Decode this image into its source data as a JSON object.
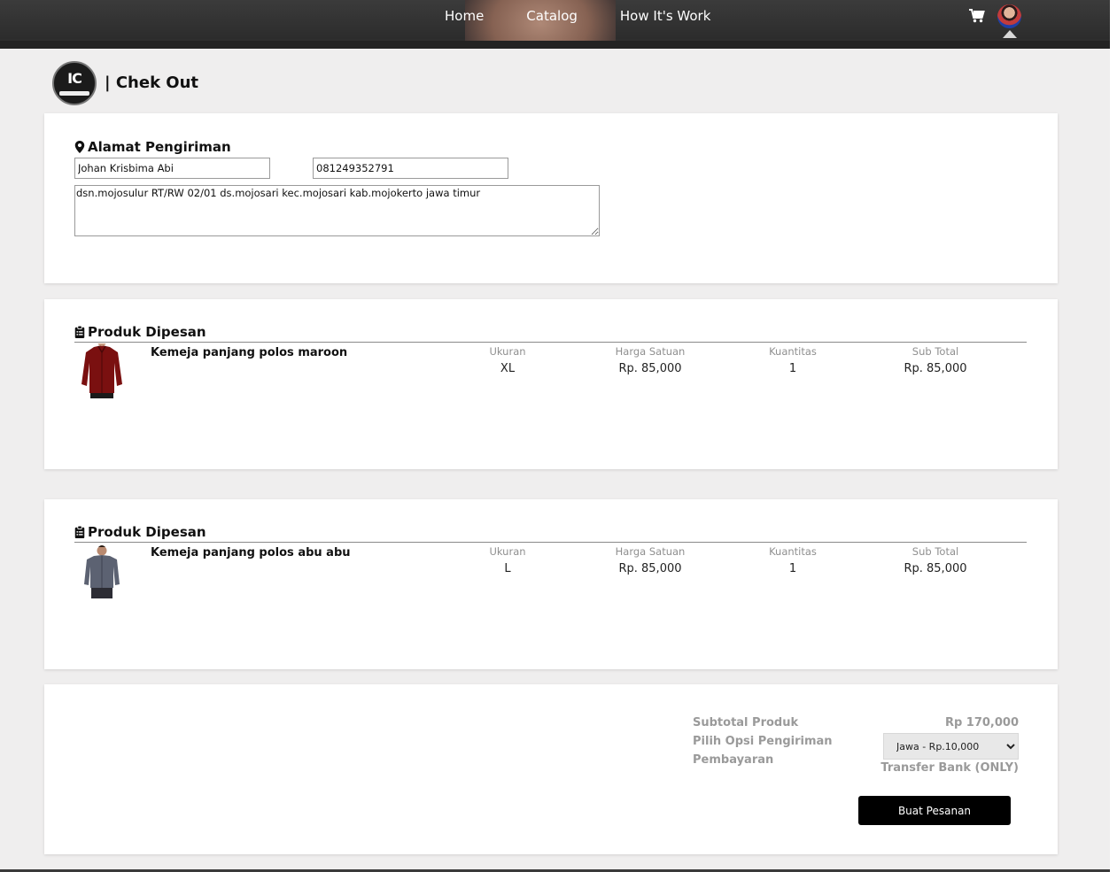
{
  "nav": {
    "links": [
      "Home",
      "Catalog",
      "How It's Work"
    ],
    "cart_icon": "cart-icon",
    "avatar": "user-avatar"
  },
  "header": {
    "logo_text": "IC",
    "title": "| Chek Out"
  },
  "address": {
    "section_title": "Alamat Pengiriman",
    "icon": "map-marker-icon",
    "name_value": "Johan Krisbima Abi",
    "phone_value": "081249352791",
    "address_value": "dsn.mojosulur RT/RW 02/01 ds.mojosari kec.mojosari kab.mojokerto jawa timur"
  },
  "columns": {
    "size": "Ukuran",
    "unit_price": "Harga Satuan",
    "qty": "Kuantitas",
    "subtotal": "Sub Total"
  },
  "orders": [
    {
      "section_title": "Produk Dipesan",
      "icon": "clipboard-list-icon",
      "product_name": "Kemeja panjang polos maroon",
      "size": "XL",
      "unit_price": "Rp. 85,000",
      "qty": "1",
      "subtotal": "Rp. 85,000",
      "image_color": "#7a1010"
    },
    {
      "section_title": "Produk Dipesan",
      "icon": "clipboard-list-icon",
      "product_name": "Kemeja panjang polos abu abu",
      "size": "L",
      "unit_price": "Rp. 85,000",
      "qty": "1",
      "subtotal": "Rp. 85,000",
      "image_color": "#5c6272"
    }
  ],
  "summary": {
    "subtotal_label": "Subtotal Produk",
    "subtotal_value": "Rp 170,000",
    "shipping_label": "Pilih Opsi Pengiriman",
    "shipping_selected": "Jawa - Rp.10,000",
    "payment_label": "Pembayaran",
    "payment_value": "Transfer Bank (ONLY)",
    "order_button": "Buat Pesanan"
  }
}
